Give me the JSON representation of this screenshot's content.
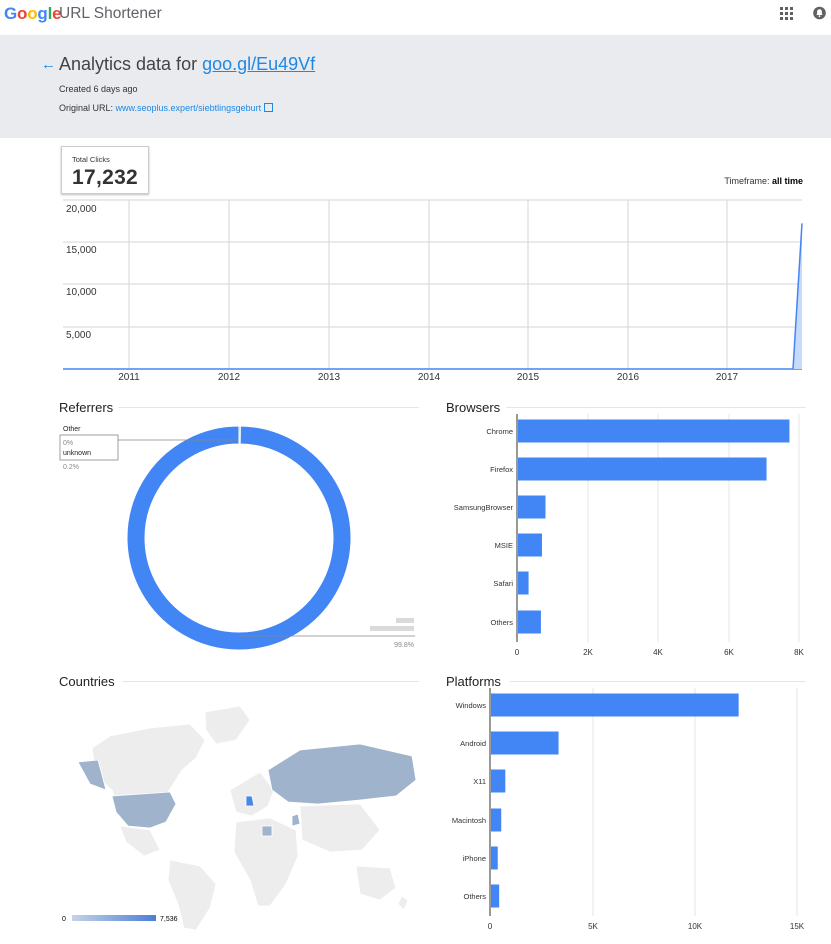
{
  "app": {
    "logo_letters": [
      {
        "ch": "G",
        "color": "#4285f4"
      },
      {
        "ch": "o",
        "color": "#ea4335"
      },
      {
        "ch": "o",
        "color": "#fbbc05"
      },
      {
        "ch": "g",
        "color": "#4285f4"
      },
      {
        "ch": "l",
        "color": "#34a853"
      },
      {
        "ch": "e",
        "color": "#ea4335"
      }
    ],
    "title": "URL Shortener",
    "apps_icon": "apps-grid-icon",
    "notifications_icon": "bell-icon"
  },
  "header": {
    "back_icon": "arrow-left-icon",
    "title_prefix": "Analytics data for ",
    "short_url": "goo.gl/Eu49Vf",
    "created": "Created 6 days ago",
    "original_url_label": "Original URL: ",
    "original_url": "www.seoplus.expert/siebtlingsgeburt",
    "external_icon": "external-link-icon"
  },
  "total": {
    "label": "Total Clicks",
    "value": "17,232"
  },
  "timeframe": {
    "label": "Timeframe: ",
    "value": "all time"
  },
  "colors": {
    "accent": "#4285f4",
    "link": "#1e88e5",
    "map_highlight": "#4a86e8",
    "map_mid": "#9fb3cc",
    "map_land": "#ededed"
  },
  "chart_data": [
    {
      "type": "area",
      "x_ticks": [
        "2011",
        "2012",
        "2013",
        "2014",
        "2015",
        "2016",
        "2017"
      ],
      "y_ticks": [
        "5,000",
        "10,000",
        "15,000",
        "20,000"
      ],
      "ylim": [
        0,
        20000
      ],
      "series": [
        {
          "values": [
            {
              "x": "2011",
              "y": 0
            },
            {
              "x": "2017-09",
              "y": 0
            },
            {
              "x": "2017-10",
              "y": 17232
            }
          ]
        }
      ],
      "grid": true
    },
    {
      "type": "pie",
      "title": "Referrers",
      "slices": [
        {
          "label": "Other",
          "pct": "0%",
          "value": 0.0
        },
        {
          "label": "unknown",
          "pct": "0.2%",
          "value": 0.2
        },
        {
          "label": "",
          "pct": "99.8%",
          "value": 99.8
        }
      ]
    },
    {
      "type": "bar",
      "title": "Browsers",
      "orientation": "horizontal",
      "categories": [
        "Chrome",
        "Firefox",
        "SamsungBrowser",
        "MSIE",
        "Safari",
        "Others"
      ],
      "values": [
        7700,
        7050,
        780,
        680,
        300,
        650
      ],
      "x_ticks": [
        "0",
        "2K",
        "4K",
        "6K",
        "8K"
      ],
      "xlim": [
        0,
        8000
      ]
    },
    {
      "type": "bar",
      "title": "Platforms",
      "orientation": "horizontal",
      "categories": [
        "Windows",
        "Android",
        "X11",
        "Macintosh",
        "iPhone",
        "Others"
      ],
      "values": [
        12100,
        3300,
        700,
        500,
        330,
        400
      ],
      "x_ticks": [
        "0",
        "5K",
        "10K",
        "15K"
      ],
      "xlim": [
        0,
        15000
      ]
    },
    {
      "type": "heatmap",
      "title": "Countries",
      "legend_min": "0",
      "legend_max": "7,536"
    }
  ]
}
